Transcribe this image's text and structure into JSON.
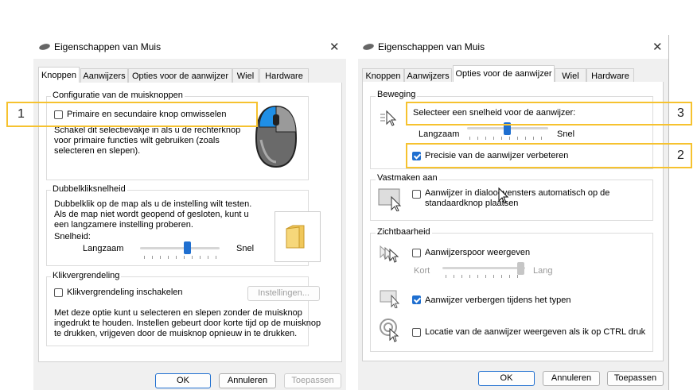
{
  "left_dialog": {
    "title": "Eigenschappen van Muis",
    "tabs": [
      "Knoppen",
      "Aanwijzers",
      "Opties voor de aanwijzer",
      "Wiel",
      "Hardware"
    ],
    "button_config": {
      "legend": "Configuratie van de muisknoppen",
      "swap_label": "Primaire en secundaire knop omwisselen",
      "description": "Schakel dit selectievakje in als u de rechterknop voor primaire functies wilt gebruiken (zoals selecteren en slepen)."
    },
    "double_click": {
      "legend": "Dubbelkliksnelheid",
      "description": "Dubbelklik op de map als u de instelling wilt testen. Als de map niet wordt geopend of gesloten, kunt u een langzamere instelling proberen.",
      "speed_label": "Snelheid:",
      "slow": "Langzaam",
      "fast": "Snel",
      "speed_value": 0.6
    },
    "click_lock": {
      "legend": "Klikvergrendeling",
      "enable_label": "Klikvergrendeling inschakelen",
      "settings_button": "Instellingen...",
      "description": "Met deze optie kunt u selecteren en slepen zonder de muisknop ingedrukt te houden. Instellen gebeurt door korte tijd op de muisknop te drukken, vrijgeven door de muisknop opnieuw in te drukken."
    },
    "buttons": {
      "ok": "OK",
      "cancel": "Annuleren",
      "apply": "Toepassen"
    }
  },
  "right_dialog": {
    "title": "Eigenschappen van Muis",
    "tabs": [
      "Knoppen",
      "Aanwijzers",
      "Opties voor de aanwijzer",
      "Wiel",
      "Hardware"
    ],
    "motion": {
      "legend": "Beweging",
      "select_speed": "Selecteer een snelheid voor de aanwijzer:",
      "slow": "Langzaam",
      "fast": "Snel",
      "speed_value": 0.5,
      "precision_label": "Precisie van de aanwijzer verbeteren"
    },
    "snap": {
      "legend": "Vastmaken aan",
      "label": "Aanwijzer in dialoogvensters automatisch op de standaardknop plaatsen"
    },
    "visibility": {
      "legend": "Zichtbaarheid",
      "trails_label": "Aanwijzerspoor weergeven",
      "short": "Kort",
      "long": "Lang",
      "trail_value": 1.0,
      "hide_label": "Aanwijzer verbergen tijdens het typen",
      "ctrl_label": "Locatie van de aanwijzer weergeven als ik op CTRL druk"
    },
    "buttons": {
      "ok": "OK",
      "cancel": "Annuleren",
      "apply": "Toepassen"
    }
  },
  "annotations": {
    "n1": "1",
    "n2": "2",
    "n3": "3"
  },
  "colors": {
    "accent": "#1f6fd0",
    "highlight": "#f6c22f"
  },
  "icons": [
    "mouse-icon",
    "folder-icon",
    "close-icon",
    "cursor-speed-icon",
    "snap-cursor-icon",
    "trail-icon",
    "hide-cursor-icon",
    "ctrl-locate-icon"
  ]
}
